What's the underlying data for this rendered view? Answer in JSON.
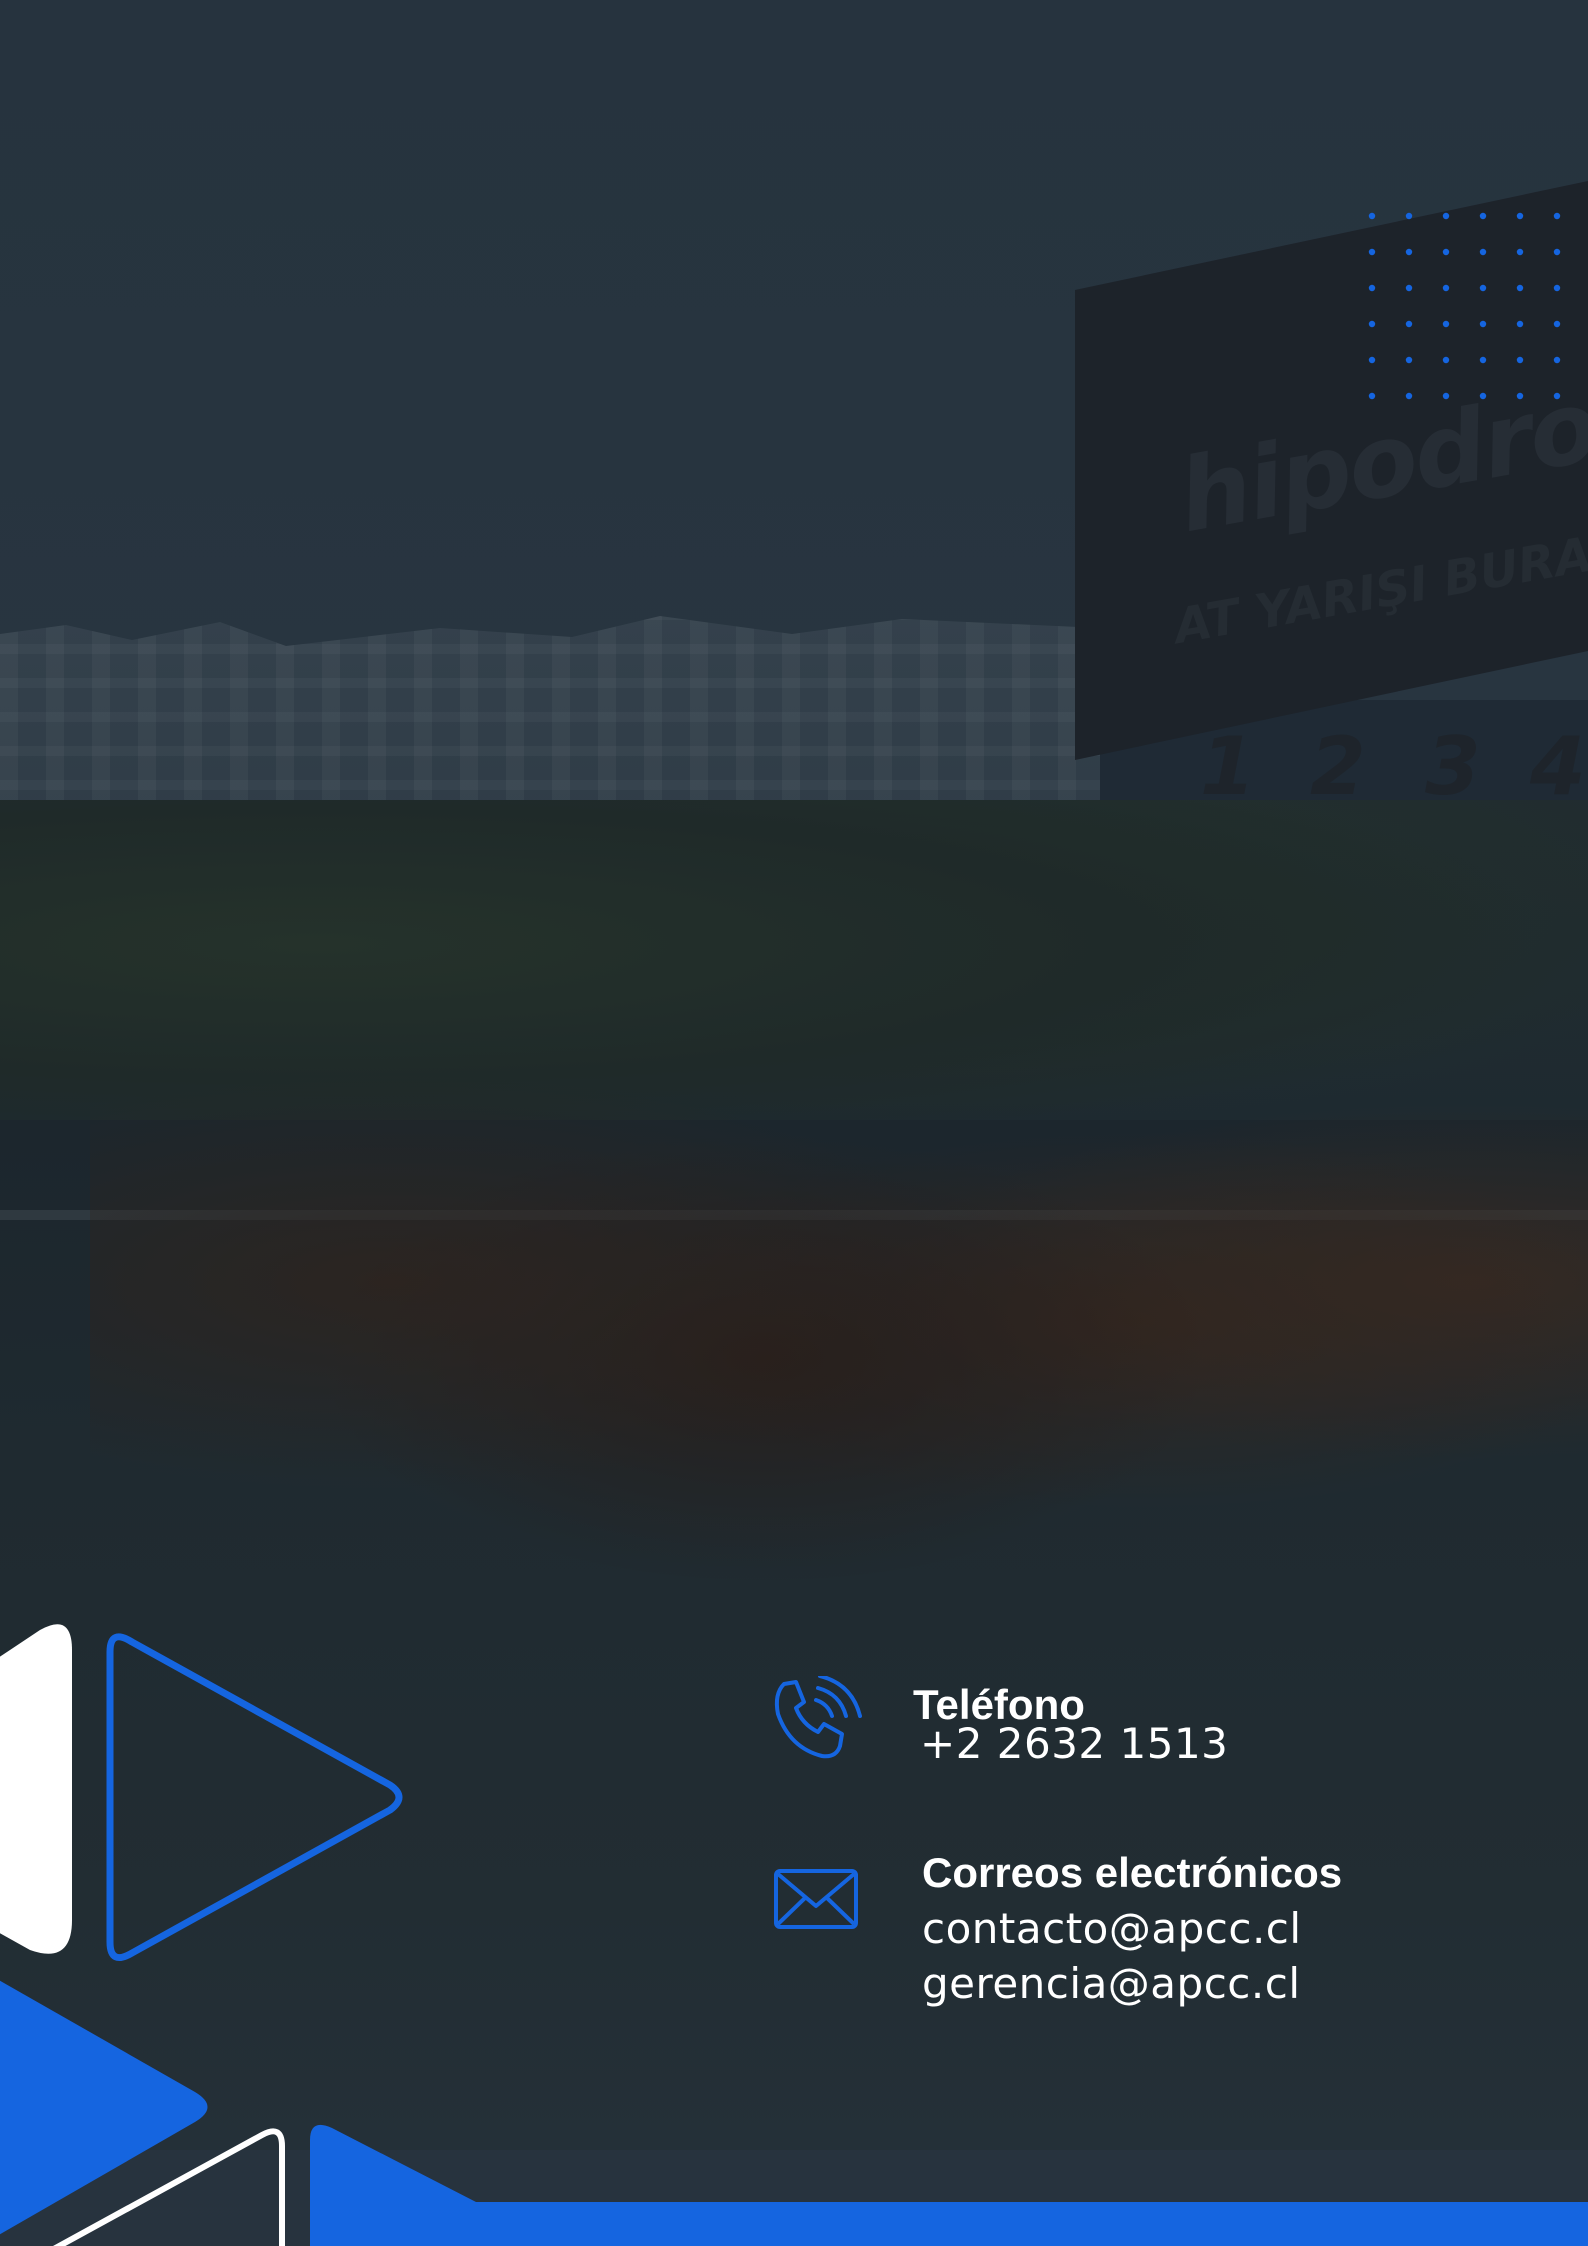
{
  "background": {
    "billboard_text": "hipodrom.c",
    "billboard_sub": "AT YARIŞI BURADA OYN",
    "gate_numbers": [
      "1",
      "2",
      "3",
      "4"
    ]
  },
  "contact": {
    "phone": {
      "icon": "phone-icon",
      "label": "Teléfono",
      "value": "+2 2632 1513"
    },
    "email": {
      "icon": "envelope-icon",
      "label": "Correos electrónicos",
      "values": [
        "contacto@apcc.cl",
        "gerencia@apcc.cl"
      ]
    }
  },
  "colors": {
    "accent": "#1565e0",
    "overlay": "#1f2a35",
    "text": "#ffffff"
  }
}
